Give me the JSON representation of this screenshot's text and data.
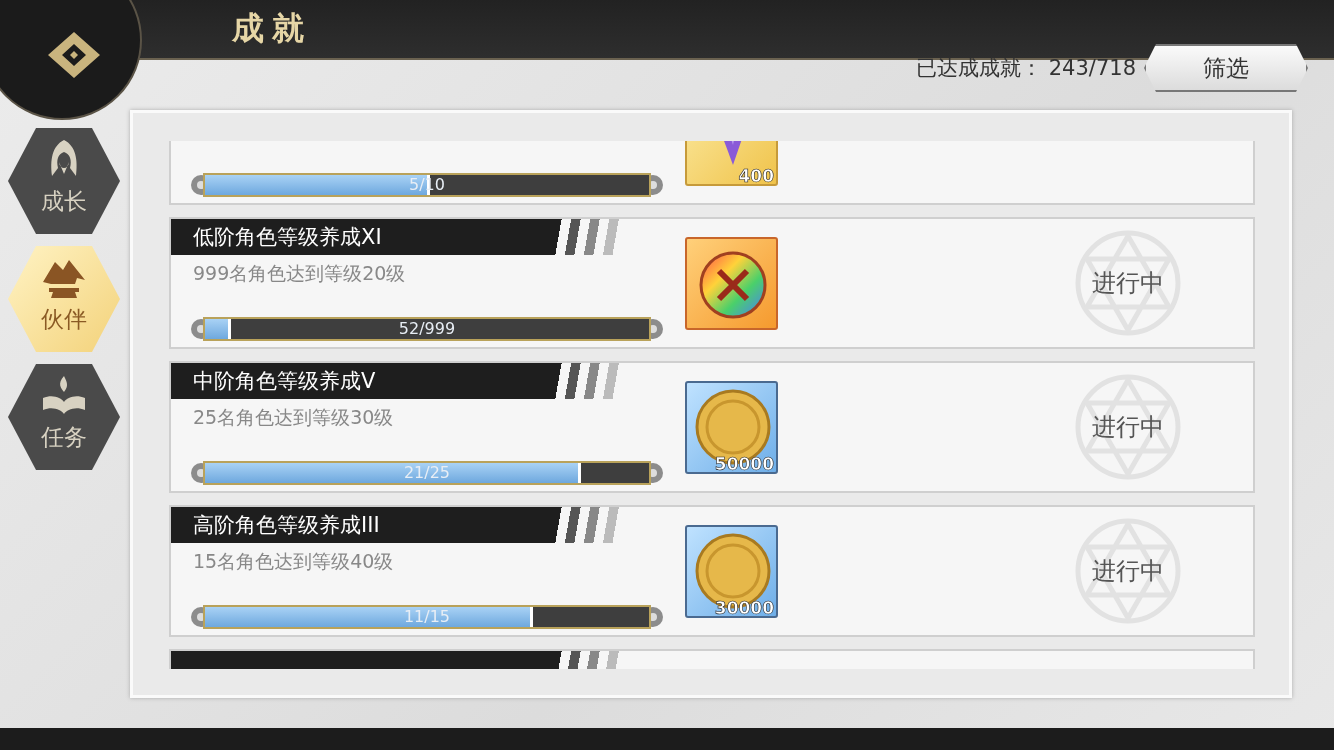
{
  "header": {
    "title": "成就"
  },
  "summary": {
    "label": "已达成成就：",
    "count": "243/718"
  },
  "filter_button": {
    "label": "筛选"
  },
  "tabs": [
    {
      "label": "成长",
      "kind": "hood",
      "selected": false
    },
    {
      "label": "伙伴",
      "kind": "mountain",
      "selected": true
    },
    {
      "label": "任务",
      "kind": "book",
      "selected": false
    }
  ],
  "achievements": [
    {
      "progress_text": "5/10",
      "level": 0.5,
      "reward": {
        "kind": "crystal",
        "count": "400"
      }
    },
    {
      "title": "低阶角色等级养成XI",
      "description": "999名角色达到等级20级",
      "progress_text": "52/999",
      "level": 0.052,
      "reward": {
        "kind": "rainbow-coin"
      },
      "status": "进行中"
    },
    {
      "title": "中阶角色等级养成V",
      "description": "25名角色达到等级30级",
      "progress_text": "21/25",
      "level": 0.84,
      "reward": {
        "kind": "gold-coin",
        "count": "50000"
      },
      "status": "进行中"
    },
    {
      "title": "高阶角色等级养成III",
      "description": "15名角色达到等级40级",
      "progress_text": "11/15",
      "level": 0.733,
      "reward": {
        "kind": "gold-coin",
        "count": "30000"
      },
      "status": "进行中"
    }
  ]
}
